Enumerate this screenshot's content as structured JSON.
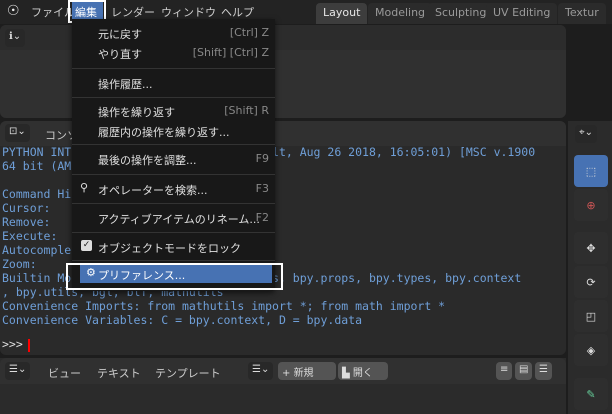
{
  "menubar": {
    "items": [
      "ファイル",
      "編集",
      "レンダー",
      "ウィンドウ",
      "ヘルプ"
    ],
    "active": "編集"
  },
  "workspaces": [
    "Layout",
    "Modeling",
    "Sculpting",
    "UV Editing",
    "Textur"
  ],
  "console": {
    "title": "コンソール",
    "lines": [
      "PYTHON INTERACTIVE CONSOLE 3.7.0 (default, Aug 26 2018, 16:05:01) [MSC v.1900",
      "64 bit (AMD64)]",
      "",
      "Command History:  Up/Down Arrow",
      "Cursor:           Left/Right Home/End",
      "Remove:           Backspace/Delete",
      "Execute:          Enter",
      "Autocomplete:     Ctrl-Space",
      "Zoom:             Ctrl +/-, Ctrl-Wheel",
      "Builtin Modules:  bpy, bpy.data, bpy.ops, bpy.props, bpy.types, bpy.context",
      ", bpy.utils, bgl, blf, mathutils",
      "Convenience Imports: from mathutils import *; from math import *",
      "Convenience Variables: C = bpy.context, D = bpy.data"
    ],
    "prompt": ">>>"
  },
  "edit_menu": {
    "items": [
      {
        "label": "元に戻す",
        "shortcut": "[Ctrl] Z"
      },
      {
        "label": "やり直す",
        "shortcut": "[Shift] [Ctrl] Z"
      },
      {
        "label": "操作履歴...",
        "shortcut": ""
      },
      {
        "label": "操作を繰り返す",
        "shortcut": "[Shift] R"
      },
      {
        "label": "履歴内の操作を繰り返す...",
        "shortcut": ""
      },
      {
        "label": "最後の操作を調整...",
        "shortcut": "F9"
      },
      {
        "label": "オペレーターを検索...",
        "shortcut": "F3"
      },
      {
        "label": "アクティブアイテムのリネーム...",
        "shortcut": "F2"
      },
      {
        "label": "オブジェクトモードをロック",
        "shortcut": "",
        "checked": true
      },
      {
        "label": "プリファレンス...",
        "shortcut": "",
        "highlighted": true
      }
    ]
  },
  "text_editor": {
    "menu": [
      "ビュー",
      "テキスト",
      "テンプレート"
    ],
    "new_label": "新規",
    "open_label": "開く"
  },
  "colors": {
    "accent": "#4772b3",
    "console_text": "#6f9fd8",
    "cursor": "#ff0000"
  }
}
